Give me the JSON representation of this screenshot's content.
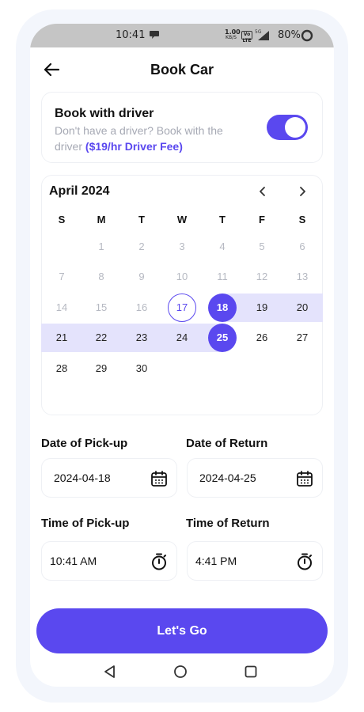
{
  "status_bar": {
    "time": "10:41",
    "net_speed": "1.00",
    "net_unit": "KB/S",
    "volte": "Vo LTE",
    "battery": "80%"
  },
  "header": {
    "title": "Book Car"
  },
  "driver": {
    "title": "Book with driver",
    "subtitle": "Don't have a driver? Book with the driver",
    "fee": "($19/hr Driver Fee)",
    "enabled": true
  },
  "calendar": {
    "month_label": "April 2024",
    "weekdays": [
      "S",
      "M",
      "T",
      "W",
      "T",
      "F",
      "S"
    ],
    "first_weekday": 1,
    "days_in_month": 30,
    "today": 17,
    "range_start": 18,
    "range_end": 25
  },
  "pickup_date": {
    "label": "Date of Pick-up",
    "value": "2024-04-18"
  },
  "return_date": {
    "label": "Date of Return",
    "value": "2024-04-25"
  },
  "pickup_time": {
    "label": "Time of Pick-up",
    "value": "10:41 AM"
  },
  "return_time": {
    "label": "Time of Return",
    "value": "4:41 PM"
  },
  "cta": {
    "label": "Let's Go"
  },
  "colors": {
    "accent": "#5a48ef",
    "range_band": "#e4e3fc",
    "muted": "#b6b9c2"
  }
}
